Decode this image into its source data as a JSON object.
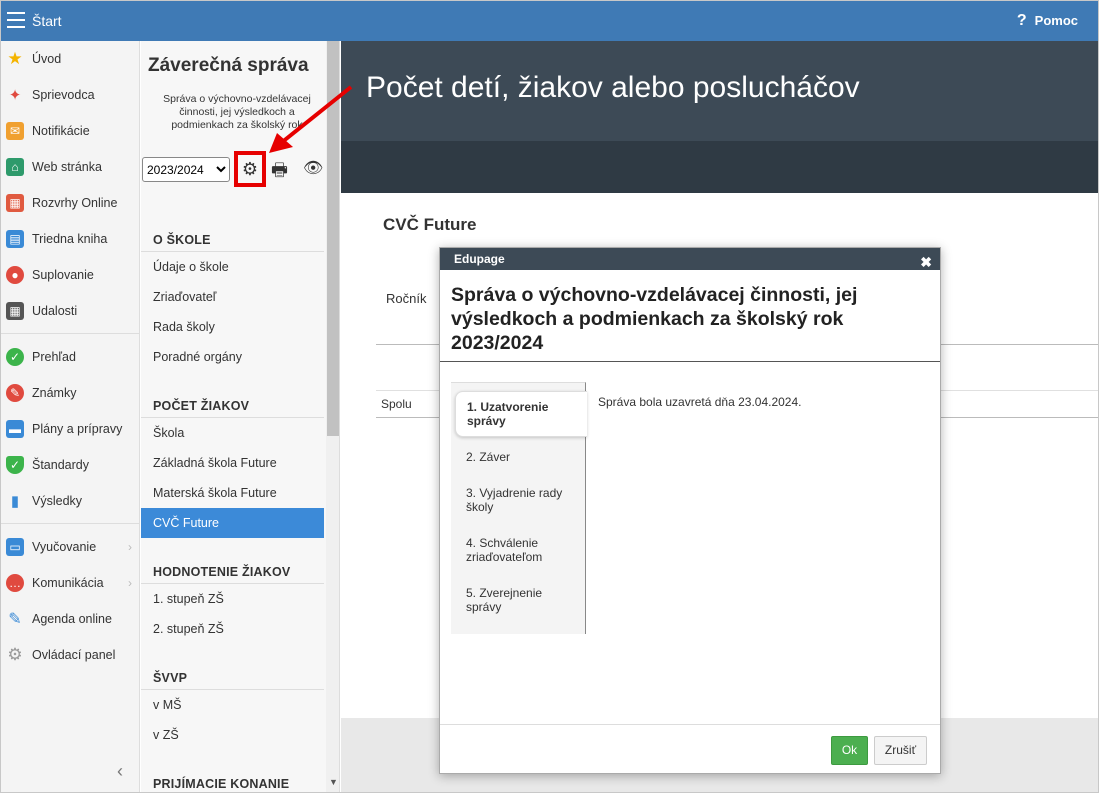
{
  "topbar": {
    "start_label": "Štart",
    "help_label": "Pomoc",
    "help_glyph": "?"
  },
  "leftnav": {
    "items": [
      {
        "label": "Úvod",
        "icon": "star-icon",
        "color": "#f4b400"
      },
      {
        "label": "Sprievodca",
        "icon": "magic-wand-icon",
        "color": "#e04a3f"
      },
      {
        "label": "Notifikácie",
        "icon": "envelope-icon",
        "color": "#f0a030"
      },
      {
        "label": "Web stránka",
        "icon": "house-icon",
        "color": "#2e9a6b"
      },
      {
        "label": "Rozvrhy Online",
        "icon": "grid-icon",
        "color": "#e05a40"
      },
      {
        "label": "Triedna kniha",
        "icon": "book-icon",
        "color": "#3a8ad6"
      },
      {
        "label": "Suplovanie",
        "icon": "user-icon",
        "color": "#e04a3f"
      },
      {
        "label": "Udalosti",
        "icon": "calendar-icon",
        "color": "#555555"
      },
      {
        "label": "Prehľad",
        "icon": "check-circle-icon",
        "color": "#3cb44b"
      },
      {
        "label": "Známky",
        "icon": "grade-icon",
        "color": "#e04a3f"
      },
      {
        "label": "Plány a prípravy",
        "icon": "briefcase-icon",
        "color": "#3a8ad6"
      },
      {
        "label": "Štandardy",
        "icon": "shield-icon",
        "color": "#3cb44b"
      },
      {
        "label": "Výsledky",
        "icon": "bar-chart-icon",
        "color": "#3a8ad6"
      },
      {
        "label": "Vyučovanie",
        "icon": "open-book-icon",
        "color": "#3a8ad6"
      },
      {
        "label": "Komunikácia",
        "icon": "chat-icon",
        "color": "#e04a3f"
      },
      {
        "label": "Agenda online",
        "icon": "pen-icon",
        "color": "#3a8ad6"
      },
      {
        "label": "Ovládací panel",
        "icon": "cog-icon",
        "color": "#999999"
      }
    ],
    "collapse_glyph": "‹"
  },
  "col2": {
    "title": "Záverečná správa",
    "subtitle": "Správa o výchovno-vzdelávacej činnosti, jej výsledkoch a podmienkach za školský rok",
    "year": "2023/2024",
    "sections": [
      {
        "head": "O ŠKOLE",
        "items": [
          "Údaje o škole",
          "Zriaďovateľ",
          "Rada školy",
          "Poradné orgány"
        ]
      },
      {
        "head": "POČET ŽIAKOV",
        "items": [
          "Škola",
          "Základná škola Future",
          "Materská škola Future",
          "CVČ Future"
        ]
      },
      {
        "head": "HODNOTENIE ŽIAKOV",
        "items": [
          "1. stupeň ZŠ",
          "2. stupeň ZŠ"
        ]
      },
      {
        "head": "ŠVVP",
        "items": [
          "v MŠ",
          "v ZŠ"
        ]
      },
      {
        "head": "PRIJÍMACIE KONANIE",
        "items": []
      }
    ],
    "active_item": "CVČ Future"
  },
  "main": {
    "title": "Počet detí, žiakov alebo poslucháčov",
    "subheading": "CVČ Future",
    "rocnik_label": "Ročník",
    "spolu_label": "Spolu"
  },
  "modal": {
    "titlebar": "Edupage",
    "close_glyph": "✖",
    "heading": "Správa o výchovno-vzdelávacej činnosti, jej výsledkoch a podmienkach za školský rok 2023/2024",
    "steps": [
      "1. Uzatvorenie správy",
      "2. Záver",
      "3. Vyjadrenie rady školy",
      "4. Schválenie zriaďovateľom",
      "5. Zverejnenie správy"
    ],
    "message": "Správa bola uzavretá dňa 23.04.2024.",
    "ok_label": "Ok",
    "cancel_label": "Zrušiť"
  },
  "colors": {
    "topbar": "#3f7ab5",
    "active_item": "#3c8ad8",
    "ok_button": "#4caf50",
    "annotation": "#e60000",
    "header_dark": "#3d4a56"
  }
}
